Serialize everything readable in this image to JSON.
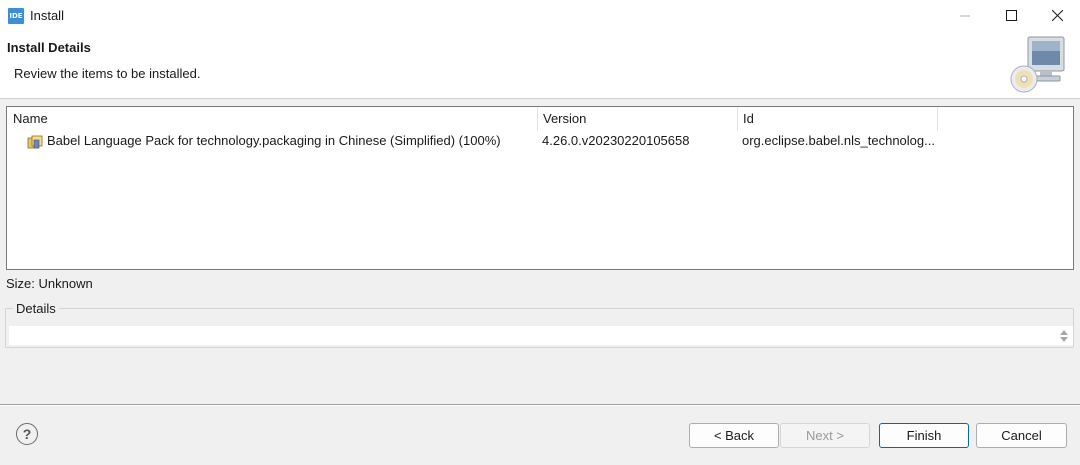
{
  "window": {
    "title": "Install",
    "app_icon_label": "IDE",
    "controls": [
      "minimize-icon",
      "maximize-icon",
      "close-icon"
    ]
  },
  "header": {
    "title": "Install Details",
    "description": "Review the items to be installed.",
    "graphic_icon": "computer-cd-icon"
  },
  "table": {
    "columns": [
      "Name",
      "Version",
      "Id"
    ],
    "rows": [
      {
        "icon": "feature-package-icon",
        "name": "Babel Language Pack for technology.packaging in Chinese (Simplified) (100%)",
        "version": "4.26.0.v20230220105658",
        "id": "org.eclipse.babel.nls_technolog..."
      }
    ]
  },
  "size_line": "Size: Unknown",
  "details": {
    "label": "Details",
    "value": ""
  },
  "buttons": {
    "help_icon": "help-icon",
    "back": "< Back",
    "next": "Next >",
    "finish": "Finish",
    "cancel": "Cancel"
  },
  "colors": {
    "accent": "#0067c0",
    "background": "#f0f0f0",
    "white": "#ffffff"
  }
}
